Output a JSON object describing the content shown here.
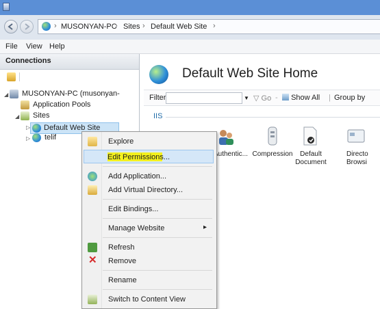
{
  "breadcrumb": [
    "MUSONYAN-PC",
    "Sites",
    "Default Web Site"
  ],
  "breadcrumb_separator": "›",
  "menubar": [
    "File",
    "View",
    "Help"
  ],
  "connections": {
    "title": "Connections",
    "tree": [
      {
        "label": "MUSONYAN-PC (musonyan-",
        "expander": "◢"
      },
      {
        "label": "Application Pools"
      },
      {
        "label": "Sites",
        "expander": "◢"
      },
      {
        "label": "Default Web Site",
        "expander": "▷"
      },
      {
        "label": "telif",
        "expander": "▷"
      }
    ]
  },
  "main": {
    "title": "Default Web Site Home",
    "filter_label": "Filter:",
    "go_label": "Go",
    "show_all_label": "Show All",
    "group_by_label": "Group by",
    "group": "IIS",
    "features": [
      {
        "label": "Authentic...",
        "icon": "authentication-icon"
      },
      {
        "label": "Compression",
        "icon": "compression-icon"
      },
      {
        "label": "Default\nDocument",
        "icon": "default-document-icon"
      },
      {
        "label": "Directo\nBrowsi",
        "icon": "directory-browsing-icon"
      }
    ]
  },
  "context_menu": {
    "items": [
      {
        "label": "Explore",
        "icon": "folder-icon"
      },
      {
        "label": "Edit Permissions...",
        "highlighted": true
      },
      {
        "label": "Add Application...",
        "icon": "add-application-icon"
      },
      {
        "label": "Add Virtual Directory...",
        "icon": "add-virtual-directory-icon"
      },
      {
        "label": "Edit Bindings..."
      },
      {
        "label": "Manage Website",
        "submenu_arrow": "▸"
      },
      {
        "label": "Refresh",
        "icon": "refresh-icon"
      },
      {
        "label": "Remove",
        "icon": "remove-icon"
      },
      {
        "label": "Rename"
      },
      {
        "label": "Switch to Content View",
        "icon": "content-view-icon"
      }
    ]
  },
  "colors": {
    "titlebar": "#5b8fd6",
    "selection": "#cce4f7",
    "highlight_marker": "#f4f11f",
    "remove_red": "#d62a2a",
    "group_header": "#1f6ba8"
  }
}
